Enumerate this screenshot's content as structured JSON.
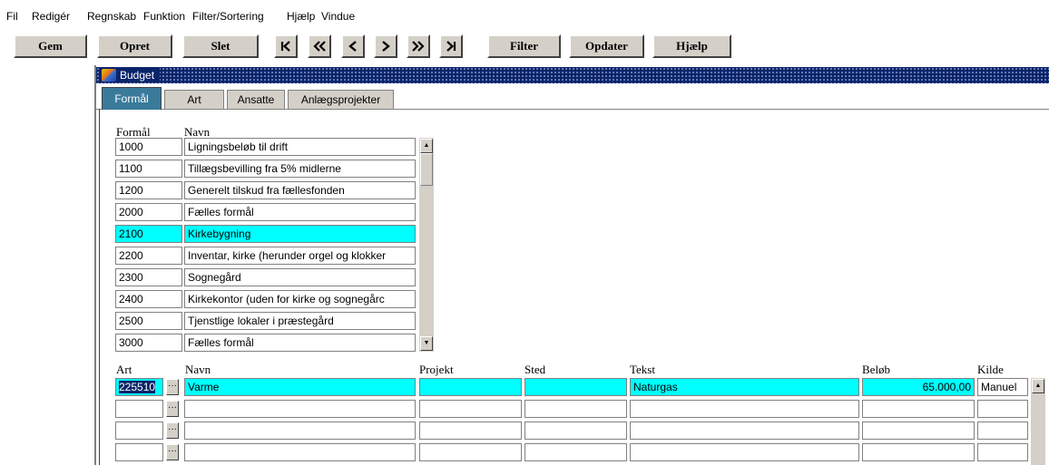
{
  "menu": [
    "Fil",
    "Redigér",
    "Regnskab",
    "Funktion",
    "Filter/Sortering",
    "Hjælp",
    "Vindue"
  ],
  "toolbar": {
    "save": "Gem",
    "create": "Opret",
    "delete": "Slet",
    "filter": "Filter",
    "update": "Opdater",
    "help": "Hjælp",
    "nav_icons": [
      "first-record-icon",
      "previous-page-icon",
      "previous-record-icon",
      "next-record-icon",
      "next-page-icon",
      "last-record-icon"
    ]
  },
  "window": {
    "title": "Budget"
  },
  "tabs": [
    "Formål",
    "Art",
    "Ansatte",
    "Anlægsprojekter"
  ],
  "formaal_table": {
    "headers": {
      "code": "Formål",
      "name": "Navn"
    },
    "rows": [
      {
        "code": "1000",
        "name": "Ligningsbeløb til drift"
      },
      {
        "code": "1100",
        "name": "Tillægsbevilling fra 5% midlerne"
      },
      {
        "code": "1200",
        "name": "Generelt tilskud fra fællesfonden"
      },
      {
        "code": "2000",
        "name": "Fælles formål"
      },
      {
        "code": "2100",
        "name": "Kirkebygning",
        "selected": true
      },
      {
        "code": "2200",
        "name": "Inventar, kirke (herunder orgel og klokker"
      },
      {
        "code": "2300",
        "name": "Sognegård"
      },
      {
        "code": "2400",
        "name": "Kirkekontor (uden for kirke og sognegårc"
      },
      {
        "code": "2500",
        "name": "Tjenstlige lokaler i præstegård"
      },
      {
        "code": "3000",
        "name": "Fælles formål"
      }
    ]
  },
  "art_table": {
    "headers": {
      "art": "Art",
      "name": "Navn",
      "project": "Projekt",
      "place": "Sted",
      "text": "Tekst",
      "amount": "Beløb",
      "source": "Kilde"
    },
    "lookup_label": "···",
    "rows": [
      {
        "art": "225510",
        "name": "Varme",
        "project": "",
        "place": "",
        "text": "Naturgas",
        "amount": "65.000,00",
        "source": "Manuel",
        "selected": true
      },
      {
        "art": "",
        "name": "",
        "project": "",
        "place": "",
        "text": "",
        "amount": "",
        "source": ""
      },
      {
        "art": "",
        "name": "",
        "project": "",
        "place": "",
        "text": "",
        "amount": "",
        "source": ""
      },
      {
        "art": "",
        "name": "",
        "project": "",
        "place": "",
        "text": "",
        "amount": "",
        "source": ""
      }
    ]
  },
  "colors": {
    "selection": "#00ffff",
    "active_tab": "#3a7a9b",
    "title_bar": "#0a246a",
    "button_face": "#d4d0c8"
  }
}
